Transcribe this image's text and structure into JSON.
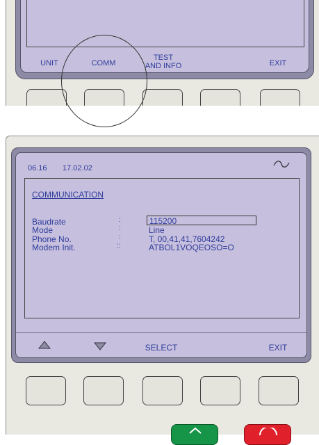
{
  "top_panel": {
    "softkeys": {
      "unit": "UNIT",
      "comm": "COMM",
      "test_line1": "TEST",
      "test_line2": "AND INFO",
      "exit": "EXIT"
    }
  },
  "screen": {
    "header": {
      "code": "06.16",
      "date": "17.02.02",
      "tilde_symbol": "~"
    },
    "title": "COMMUNICATION",
    "fields": [
      {
        "label": "Baudrate",
        "separator": ":",
        "value": "115200"
      },
      {
        "label": "Mode",
        "separator": ":",
        "value": "Line"
      },
      {
        "label": "Phone No.",
        "separator": ":",
        "value": "T, 00,41,41,7604242"
      },
      {
        "label": "Modem Init.",
        "separator": "::",
        "value": "ATBOL1VOQEOSO=O"
      }
    ],
    "softkeys": {
      "up_icon": "triangle-up",
      "down_icon": "triangle-down",
      "select": "SELECT",
      "exit": "EXIT"
    }
  },
  "colors": {
    "lcd_background": "#c6c0de",
    "lcd_text": "#2f3b9a",
    "bezel": "#8d8aa6",
    "device_body": "#e9e8e1",
    "green_button": "#169447",
    "red_button": "#e0212b"
  }
}
